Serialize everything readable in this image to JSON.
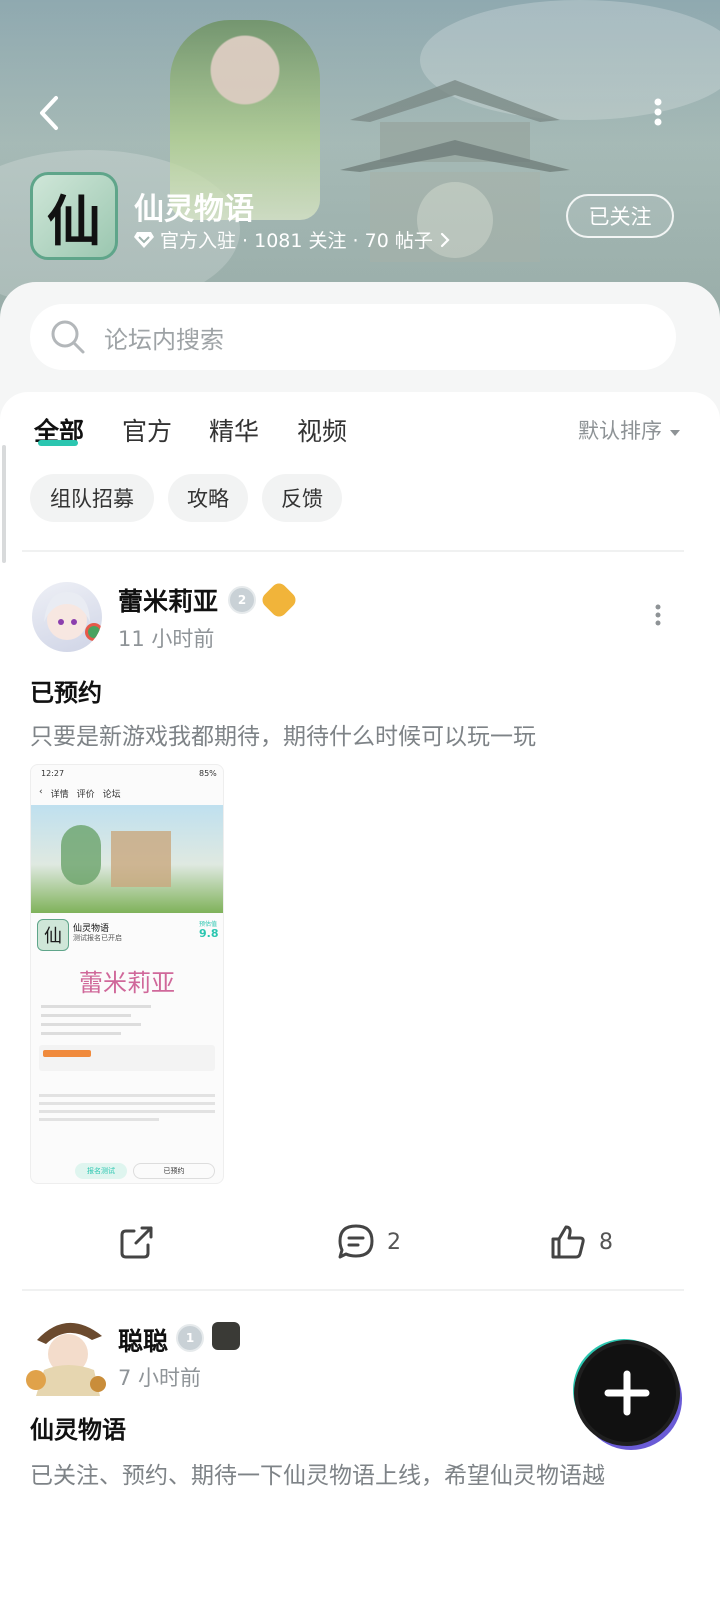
{
  "header": {
    "forum_name": "仙灵物语",
    "logo_char": "仙",
    "meta": "官方入驻 · 1081 关注 · 70 帖子",
    "follow_label": "已关注"
  },
  "search": {
    "placeholder": "论坛内搜索"
  },
  "tabs": [
    {
      "label": "全部",
      "active": true
    },
    {
      "label": "官方"
    },
    {
      "label": "精华"
    },
    {
      "label": "视频"
    }
  ],
  "sort_label": "默认排序",
  "chips": [
    "组队招募",
    "攻略",
    "反馈"
  ],
  "posts": [
    {
      "username": "蕾米莉亚",
      "level": "2",
      "time": "11 小时前",
      "title": "已预约",
      "body": "只要是新游戏我都期待，期待什么时候可以玩一玩",
      "share_label": "",
      "comments": "2",
      "likes": "8"
    },
    {
      "username": "聪聪",
      "level": "1",
      "time": "7 小时前",
      "title": "仙灵物语",
      "body": "已关注、预约、期待一下仙灵物语上线，希望仙灵物语越"
    }
  ],
  "screenshot": {
    "status_time": "12:27",
    "battery": "85%",
    "nav_tabs": [
      "详情",
      "评价",
      "论坛"
    ],
    "game_name": "仙灵物语",
    "game_sub": "测试报名已开启",
    "score_label": "预估值",
    "score": "9.8",
    "watermark": "蕾米莉亚",
    "btn_signup": "报名测试",
    "btn_reserved": "已预约"
  },
  "colors": {
    "accent": "#2bc6b0",
    "fab": "#111111"
  }
}
